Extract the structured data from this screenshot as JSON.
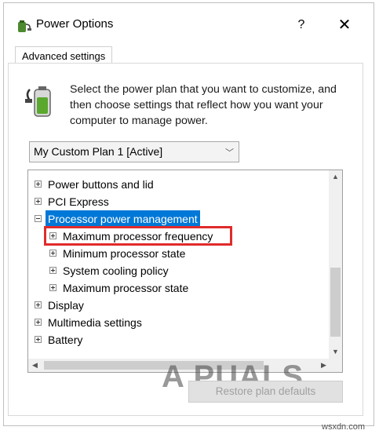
{
  "window": {
    "title": "Power Options",
    "help_label": "?",
    "close_label": "✕"
  },
  "tab": {
    "label": "Advanced settings"
  },
  "intro_text": "Select the power plan that you want to customize, and then choose settings that reflect how you want your computer to manage power.",
  "plan_select": {
    "value": "My Custom Plan 1 [Active]"
  },
  "tree": {
    "items": [
      {
        "label": "Power buttons and lid",
        "state": "collapsed"
      },
      {
        "label": "PCI Express",
        "state": "collapsed"
      },
      {
        "label": "Processor power management",
        "state": "expanded",
        "selected": true
      },
      {
        "label": "Maximum processor frequency",
        "state": "collapsed",
        "highlighted": true
      },
      {
        "label": "Minimum processor state",
        "state": "collapsed"
      },
      {
        "label": "System cooling policy",
        "state": "collapsed"
      },
      {
        "label": "Maximum processor state",
        "state": "collapsed"
      },
      {
        "label": "Display",
        "state": "collapsed"
      },
      {
        "label": "Multimedia settings",
        "state": "collapsed"
      },
      {
        "label": "Battery",
        "state": "collapsed"
      }
    ]
  },
  "restore_button": {
    "label": "Restore plan defaults",
    "enabled": false
  },
  "watermark": {
    "text": "A  PUALS"
  },
  "site": {
    "text": "wsxdn.com"
  },
  "colors": {
    "selection": "#0078d7",
    "highlight_box": "#e02b2b"
  }
}
